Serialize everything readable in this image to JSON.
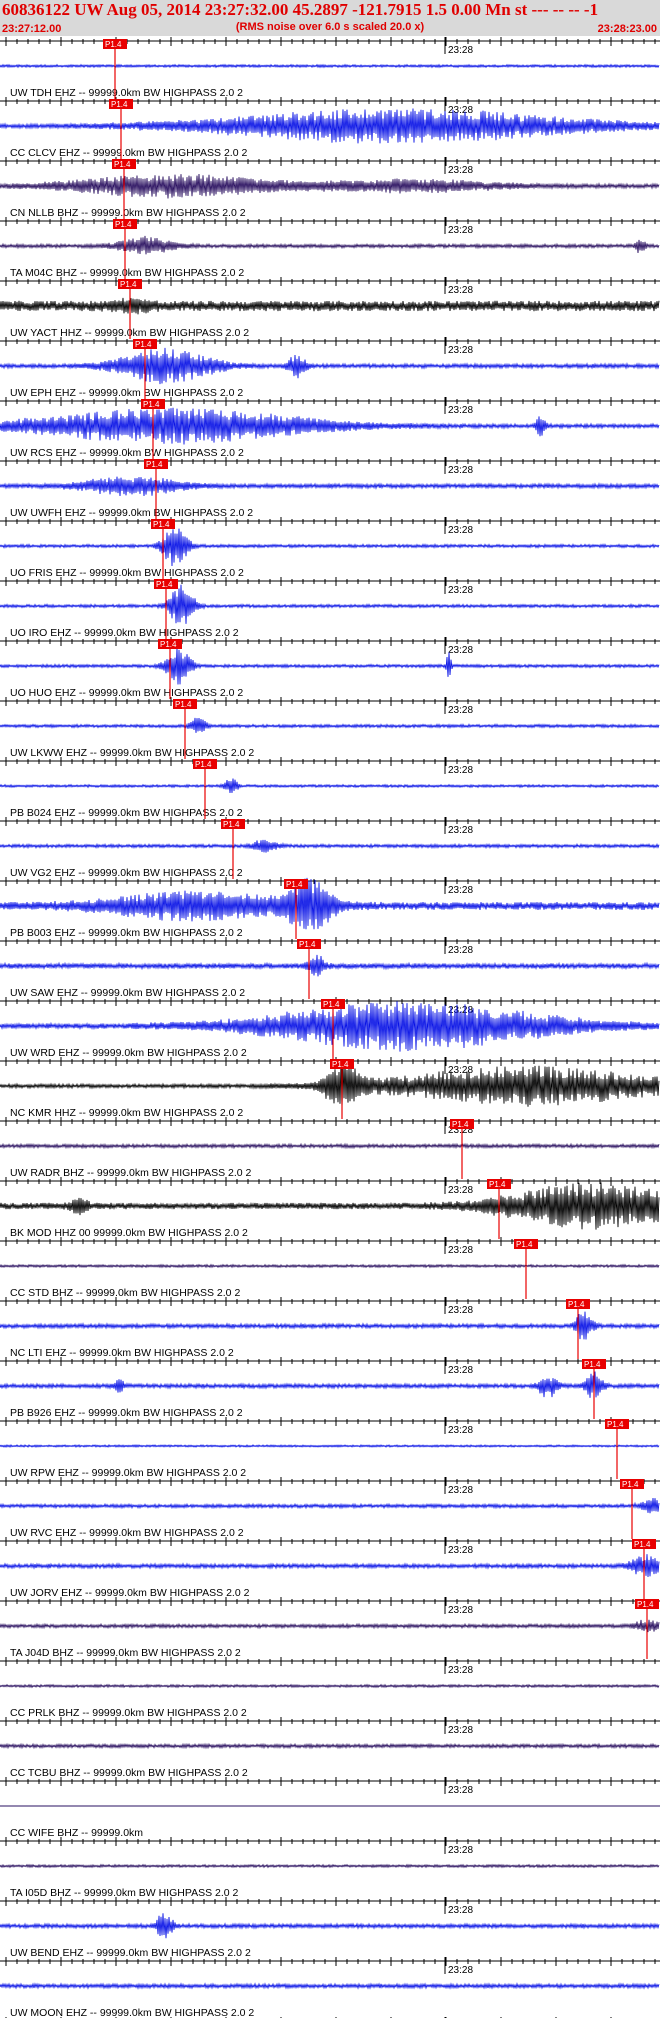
{
  "header": {
    "title": "60836122 UW Aug 05, 2014 23:27:32.00   45.2897 -121.7915  1.5 0.00 Mn st --- -- --  -1",
    "subtitle": "(RMS noise over 6.0 s scaled 20.0 x)",
    "time_start": "23:27:12.00",
    "time_end": "23:28:23.00"
  },
  "minute_label": "23:28",
  "pick_label": "P1.4",
  "colors": {
    "title": "#e00000",
    "header_bg": "#d9d9d9",
    "blue_trace": "#0a14e6",
    "dark_trace": "#2a1060",
    "black_trace": "#000000",
    "pick": "#e80000"
  },
  "traces": [
    {
      "label": "UW TDH EHZ -- 99999.0km BW  HIGHPASS  2.0  2",
      "color": "blue",
      "pick": 0.175,
      "amp": 1.0,
      "burst": 0.0,
      "burst_at": 0.2,
      "burst_len": 0.1,
      "extra": []
    },
    {
      "label": "CC CLCV EHZ -- 99999.0km BW  HIGHPASS  2.0  2",
      "color": "blue",
      "pick": 0.183,
      "amp": 1.6,
      "burst": 14,
      "burst_at": 0.6,
      "burst_len": 0.45,
      "extra": []
    },
    {
      "label": "CN NLLB BHZ -- 99999.0km BW  HIGHPASS  2.0  2",
      "color": "dark",
      "pick": 0.188,
      "amp": 1.6,
      "burst": 9,
      "burst_at": 0.26,
      "burst_len": 0.25,
      "extra": [
        [
          0.62,
          0.2,
          5
        ]
      ]
    },
    {
      "label": "TA M04C BHZ -- 99999.0km BW  HIGHPASS  2.0  2",
      "color": "dark",
      "pick": 0.19,
      "amp": 1.4,
      "burst": 7,
      "burst_at": 0.22,
      "burst_len": 0.07,
      "extra": [
        [
          0.97,
          0.01,
          7
        ]
      ]
    },
    {
      "label": "UW YACT HHZ -- 99999.0km BW  HIGHPASS  2.0  2",
      "color": "black",
      "pick": 0.197,
      "amp": 4.0,
      "burst": 4,
      "burst_at": 0.2,
      "burst_len": 0.05,
      "extra": []
    },
    {
      "label": "UW EPH EHZ -- 99999.0km BW  HIGHPASS  2.0  2",
      "color": "blue",
      "pick": 0.22,
      "amp": 1.6,
      "burst": 14,
      "burst_at": 0.25,
      "burst_len": 0.12,
      "extra": [
        [
          0.45,
          0.02,
          9
        ]
      ]
    },
    {
      "label": "UW RCS EHZ -- 99999.0km BW  HIGHPASS  2.0  2",
      "color": "blue",
      "pick": 0.232,
      "amp": 1.6,
      "burst": 14,
      "burst_at": 0.26,
      "burst_len": 0.35,
      "extra": [
        [
          0.82,
          0.01,
          10
        ]
      ]
    },
    {
      "label": "UW UWFH EHZ -- 99999.0km BW  HIGHPASS  2.0  2",
      "color": "blue",
      "pick": 0.237,
      "amp": 1.6,
      "burst": 8,
      "burst_at": 0.2,
      "burst_len": 0.12,
      "extra": []
    },
    {
      "label": "UO FRIS EHZ -- 99999.0km BW  HIGHPASS  2.0  2",
      "color": "blue",
      "pick": 0.247,
      "amp": 1.2,
      "burst": 17,
      "burst_at": 0.265,
      "burst_len": 0.03,
      "extra": []
    },
    {
      "label": "UO IRO EHZ -- 99999.0km BW  HIGHPASS  2.0  2",
      "color": "blue",
      "pick": 0.252,
      "amp": 1.2,
      "burst": 18,
      "burst_at": 0.275,
      "burst_len": 0.03,
      "extra": []
    },
    {
      "label": "UO HUO EHZ -- 99999.0km BW  HIGHPASS  2.0  2",
      "color": "blue",
      "pick": 0.258,
      "amp": 1.2,
      "burst": 16,
      "burst_at": 0.27,
      "burst_len": 0.03,
      "extra": [
        [
          0.68,
          0.005,
          14
        ]
      ]
    },
    {
      "label": "UW LKWW EHZ -- 99999.0km BW  HIGHPASS  2.0  2",
      "color": "blue",
      "pick": 0.28,
      "amp": 1.2,
      "burst": 7,
      "burst_at": 0.3,
      "burst_len": 0.02,
      "extra": []
    },
    {
      "label": "PB B024 EHZ -- 99999.0km BW  HIGHPASS  2.0  2",
      "color": "blue",
      "pick": 0.31,
      "amp": 1.0,
      "burst": 7,
      "burst_at": 0.35,
      "burst_len": 0.015,
      "extra": []
    },
    {
      "label": "UW VG2 EHZ -- 99999.0km BW  HIGHPASS  2.0  2",
      "color": "blue",
      "pick": 0.353,
      "amp": 1.3,
      "burst": 5,
      "burst_at": 0.4,
      "burst_len": 0.03,
      "extra": []
    },
    {
      "label": "PB B003 EHZ -- 99999.0km BW  HIGHPASS  2.0  2",
      "color": "blue",
      "pick": 0.448,
      "amp": 3.0,
      "burst": 22,
      "burst_at": 0.47,
      "burst_len": 0.05,
      "extra": [
        [
          0.3,
          0.2,
          11
        ]
      ]
    },
    {
      "label": "UW SAW EHZ -- 99999.0km BW  HIGHPASS  2.0  2",
      "color": "blue",
      "pick": 0.468,
      "amp": 2.0,
      "burst": 9,
      "burst_at": 0.48,
      "burst_len": 0.02,
      "extra": []
    },
    {
      "label": "UW WRD EHZ -- 99999.0km BW  HIGHPASS  2.0  2",
      "color": "blue",
      "pick": 0.505,
      "amp": 2.0,
      "burst": 20,
      "burst_at": 0.62,
      "burst_len": 0.35,
      "extra": []
    },
    {
      "label": "NC KMR HHZ -- 99999.0km BW  HIGHPASS  2.0  2",
      "color": "black",
      "pick": 0.518,
      "amp": 1.5,
      "burst": 16,
      "burst_at": 0.8,
      "burst_len": 0.35,
      "extra": [
        [
          0.52,
          0.04,
          16
        ]
      ]
    },
    {
      "label": "UW RADR BHZ -- 99999.0km BW  HIGHPASS  2.0  2",
      "color": "dark",
      "pick": 0.7,
      "amp": 1.4,
      "burst": 0,
      "burst_at": 0.7,
      "burst_len": 0.1,
      "extra": []
    },
    {
      "label": "BK MOD HHZ 00 99999.0km BW  HIGHPASS  2.0  2",
      "color": "black",
      "pick": 0.756,
      "amp": 2.5,
      "burst": 18,
      "burst_at": 0.9,
      "burst_len": 0.22,
      "extra": [
        [
          0.12,
          0.02,
          6
        ]
      ]
    },
    {
      "label": "CC STD BHZ -- 99999.0km BW  HIGHPASS  2.0  2",
      "color": "dark",
      "pick": 0.797,
      "amp": 1.0,
      "burst": 0,
      "burst_at": 0.8,
      "burst_len": 0.1,
      "extra": []
    },
    {
      "label": "NC LTI EHZ -- 99999.0km BW  HIGHPASS  2.0  2",
      "color": "blue",
      "pick": 0.875,
      "amp": 1.6,
      "burst": 14,
      "burst_at": 0.885,
      "burst_len": 0.02,
      "extra": []
    },
    {
      "label": "PB B926 EHZ -- 99999.0km BW  HIGHPASS  2.0  2",
      "color": "blue",
      "pick": 0.9,
      "amp": 1.6,
      "burst": 12,
      "burst_at": 0.9,
      "burst_len": 0.02,
      "extra": [
        [
          0.83,
          0.02,
          10
        ],
        [
          0.18,
          0.01,
          6
        ]
      ]
    },
    {
      "label": "UW RPW EHZ -- 99999.0km BW  HIGHPASS  2.0  2",
      "color": "blue",
      "pick": 0.935,
      "amp": 0.8,
      "burst": 0,
      "burst_at": 0.94,
      "burst_len": 0.1,
      "extra": []
    },
    {
      "label": "UW RVC EHZ -- 99999.0km BW  HIGHPASS  2.0  2",
      "color": "blue",
      "pick": 0.957,
      "amp": 1.4,
      "burst": 6,
      "burst_at": 0.99,
      "burst_len": 0.03,
      "extra": []
    },
    {
      "label": "UW JORV EHZ -- 99999.0km BW  HIGHPASS  2.0  2",
      "color": "blue",
      "pick": 0.975,
      "amp": 1.6,
      "burst": 9,
      "burst_at": 0.98,
      "burst_len": 0.04,
      "extra": []
    },
    {
      "label": "TA J04D BHZ -- 99999.0km BW  HIGHPASS  2.0  2",
      "color": "dark",
      "pick": 0.98,
      "amp": 1.4,
      "burst": 5,
      "burst_at": 0.98,
      "burst_len": 0.03,
      "extra": []
    },
    {
      "label": "CC PRLK BHZ -- 99999.0km BW  HIGHPASS  2.0  2",
      "color": "dark",
      "pick": null,
      "amp": 1.0,
      "burst": 0,
      "burst_at": 0.5,
      "burst_len": 0.1,
      "extra": []
    },
    {
      "label": "CC TCBU BHZ -- 99999.0km BW  HIGHPASS  2.0  2",
      "color": "dark",
      "pick": null,
      "amp": 1.4,
      "burst": 0,
      "burst_at": 0.5,
      "burst_len": 0.1,
      "extra": []
    },
    {
      "label": "CC WIFE BHZ -- 99999.0km",
      "color": "dark",
      "pick": null,
      "amp": 0.0,
      "burst": 0,
      "burst_at": 0.5,
      "burst_len": 0.1,
      "extra": []
    },
    {
      "label": "TA I05D BHZ -- 99999.0km BW  HIGHPASS  2.0  2",
      "color": "dark",
      "pick": null,
      "amp": 1.0,
      "burst": 0,
      "burst_at": 0.5,
      "burst_len": 0.1,
      "extra": []
    },
    {
      "label": "UW BEND EHZ -- 99999.0km BW  HIGHPASS  2.0  2",
      "color": "blue",
      "pick": null,
      "amp": 1.6,
      "burst": 12,
      "burst_at": 0.25,
      "burst_len": 0.02,
      "extra": []
    },
    {
      "label": "UW MOON EHZ -- 99999.0km BW  HIGHPASS  2.0  2",
      "color": "blue",
      "pick": null,
      "amp": 1.6,
      "burst": 0,
      "burst_at": 0.5,
      "burst_len": 0.1,
      "extra": []
    }
  ]
}
